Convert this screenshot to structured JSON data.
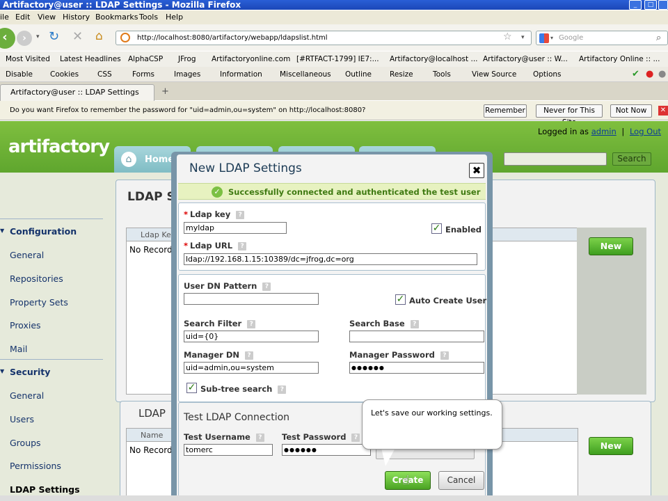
{
  "window": {
    "title": "Artifactory@user :: LDAP Settings - Mozilla Firefox"
  },
  "menu": [
    "ile",
    "Edit",
    "View",
    "History",
    "Bookmarks",
    "Tools",
    "Help"
  ],
  "nav": {
    "url": "http://localhost:8080/artifactory/webapp/ldapslist.html",
    "search_placeholder": "Google"
  },
  "bookmarks": [
    "Most Visited",
    "Latest Headlines",
    "AlphaCSP",
    "JFrog",
    "Artifactoryonline.com",
    "[#RTFACT-1799] IE7:...",
    "Artifactory@localhost ...",
    "Artifactory@user :: W...",
    "Artifactory Online :: ..."
  ],
  "devbar": [
    "Disable",
    "Cookies",
    "CSS",
    "Forms",
    "Images",
    "Information",
    "Miscellaneous",
    "Outline",
    "Resize",
    "Tools",
    "View Source",
    "Options"
  ],
  "tab": {
    "label": "Artifactory@user :: LDAP Settings"
  },
  "notification": {
    "message": "Do you want Firefox to remember the password for \"uid=admin,ou=system\" on http://localhost:8080?",
    "remember": "Remember",
    "never": "Never for This Site",
    "not_now": "Not Now"
  },
  "header": {
    "logo": "artifactory",
    "logged_in_prefix": "Logged in as",
    "user": "admin",
    "separator": "|",
    "logout": "Log Out",
    "home_tab": "Home",
    "search_button": "Search"
  },
  "sidebar": {
    "configuration": "Configuration",
    "config_items": [
      "General",
      "Repositories",
      "Property Sets",
      "Proxies",
      "Mail"
    ],
    "security": "Security",
    "security_items": [
      "General",
      "Users",
      "Groups",
      "Permissions",
      "LDAP Settings"
    ]
  },
  "main": {
    "panel1_title": "LDAP S",
    "panel1_col": "Ldap Ke",
    "panel1_empty": "No Records",
    "panel2_title": "LDAP",
    "panel2_col": "Name",
    "panel2_empty": "No Records",
    "new_label": "New"
  },
  "modal": {
    "title": "New LDAP Settings",
    "close": "✖",
    "success": "Successfully connected and authenticated the test user",
    "ldap_key_label": "Ldap key",
    "ldap_key_value": "myldap",
    "enabled_label": "Enabled",
    "ldap_url_label": "Ldap URL",
    "ldap_url_value": "ldap://192.168.1.15:10389/dc=jfrog,dc=org",
    "user_dn_label": "User DN Pattern",
    "user_dn_value": "",
    "auto_create_label": "Auto Create User",
    "search_filter_label": "Search Filter",
    "search_filter_value": "uid={0}",
    "search_base_label": "Search Base",
    "search_base_value": "",
    "manager_dn_label": "Manager DN",
    "manager_dn_value": "uid=admin,ou=system",
    "manager_password_label": "Manager Password",
    "manager_password_value": "●●●●●●",
    "subtree_label": "Sub-tree search",
    "test_title": "Test LDAP Connection",
    "test_username_label": "Test Username",
    "test_username_value": "tomerc",
    "test_password_label": "Test Password",
    "test_password_value": "●●●●●●",
    "save": "Create",
    "cancel": "Cancel"
  },
  "tooltip": {
    "text": "Let's save our working settings."
  }
}
